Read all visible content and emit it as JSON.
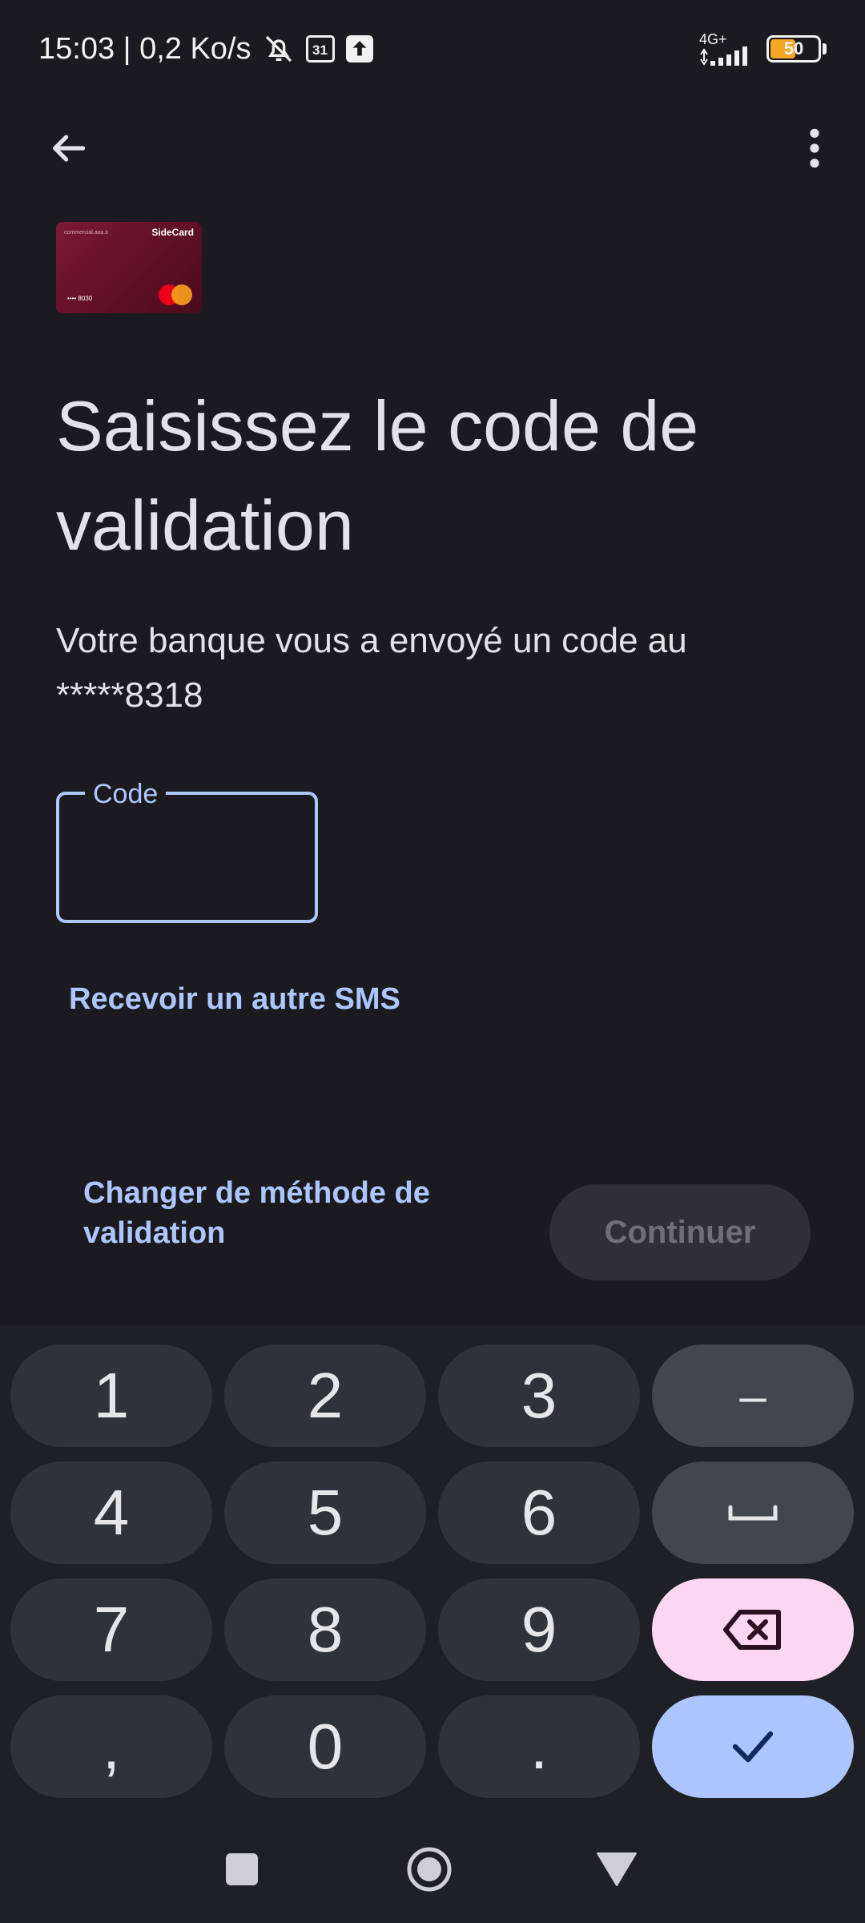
{
  "status_bar": {
    "time_speed": "15:03 | 0,2 Ko/s",
    "calendar_day": "31",
    "network": "4G+",
    "battery": "50"
  },
  "card": {
    "issuer_small": "commercial.aaa.it",
    "brand": "SideCard",
    "number": "•••• 8030"
  },
  "page": {
    "title": "Saisissez le code de validation",
    "description": "Votre banque vous a envoyé un code au *****8318",
    "code_label": "Code",
    "code_value": "",
    "resend_link": "Recevoir un autre SMS",
    "change_method_link": "Changer de méthode de validation",
    "continue_button": "Continuer"
  },
  "keyboard": {
    "k1": "1",
    "k2": "2",
    "k3": "3",
    "dash": "–",
    "k4": "4",
    "k5": "5",
    "k6": "6",
    "space_icon": "space-icon",
    "k7": "7",
    "k8": "8",
    "k9": "9",
    "backspace_icon": "backspace-icon",
    "comma": ",",
    "k0": "0",
    "period": ".",
    "enter_icon": "check-icon"
  },
  "colors": {
    "background": "#1b1b1f",
    "accent": "#aec6ff",
    "backspace_key": "#fbd7f4",
    "card": "#6a1430"
  }
}
